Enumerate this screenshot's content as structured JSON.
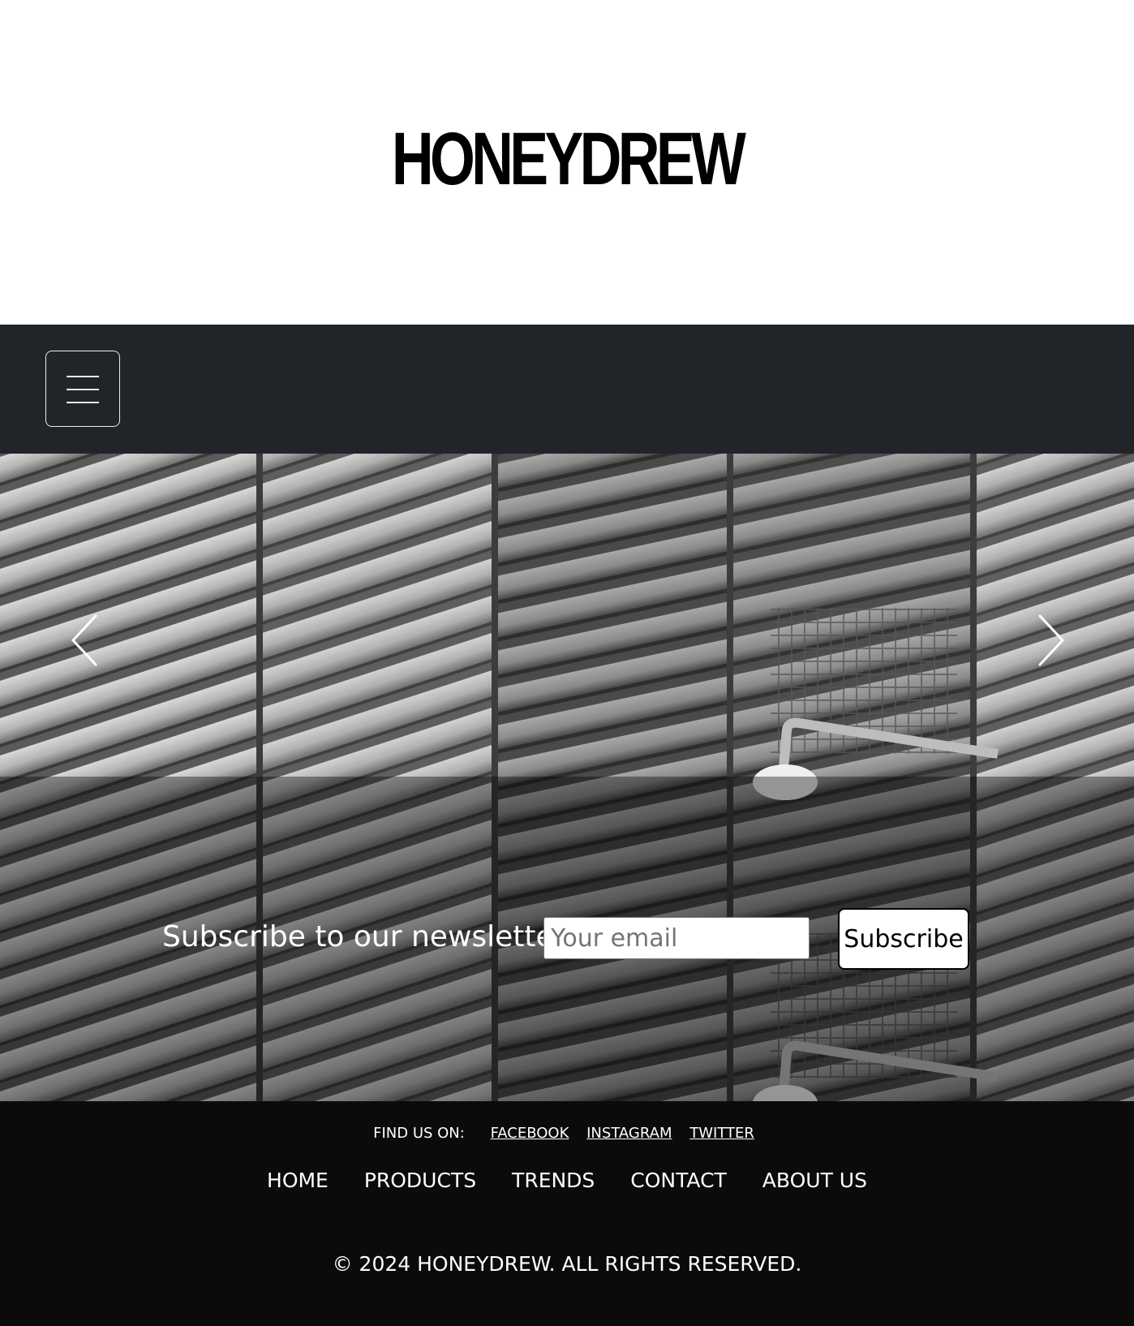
{
  "header": {
    "logo_text": "HONEYDREW"
  },
  "navbar": {
    "menu_toggle_icon": "hamburger-menu-icon"
  },
  "hero": {
    "image_subject": "black-and-white photo of angled building louvers",
    "prev_icon": "chevron-left-icon",
    "next_icon": "chevron-right-icon"
  },
  "newsletter": {
    "title": "Subscribe to our newsletter!",
    "email_placeholder": "Your email",
    "email_value": "",
    "button_label": "Subscribe"
  },
  "footer": {
    "find_us_label": "FIND US ON:",
    "social_links": [
      "FACEBOOK",
      "INSTAGRAM",
      "TWITTER"
    ],
    "nav_links": [
      "HOME",
      "PRODUCTS",
      "TRENDS",
      "CONTACT",
      "ABOUT US"
    ],
    "copyright": "© 2024 HONEYDREW. ALL RIGHTS RESERVED."
  },
  "colors": {
    "navbar_bg": "#212529",
    "footer_bg": "#0b0b0b",
    "page_bg": "#ffffff"
  }
}
